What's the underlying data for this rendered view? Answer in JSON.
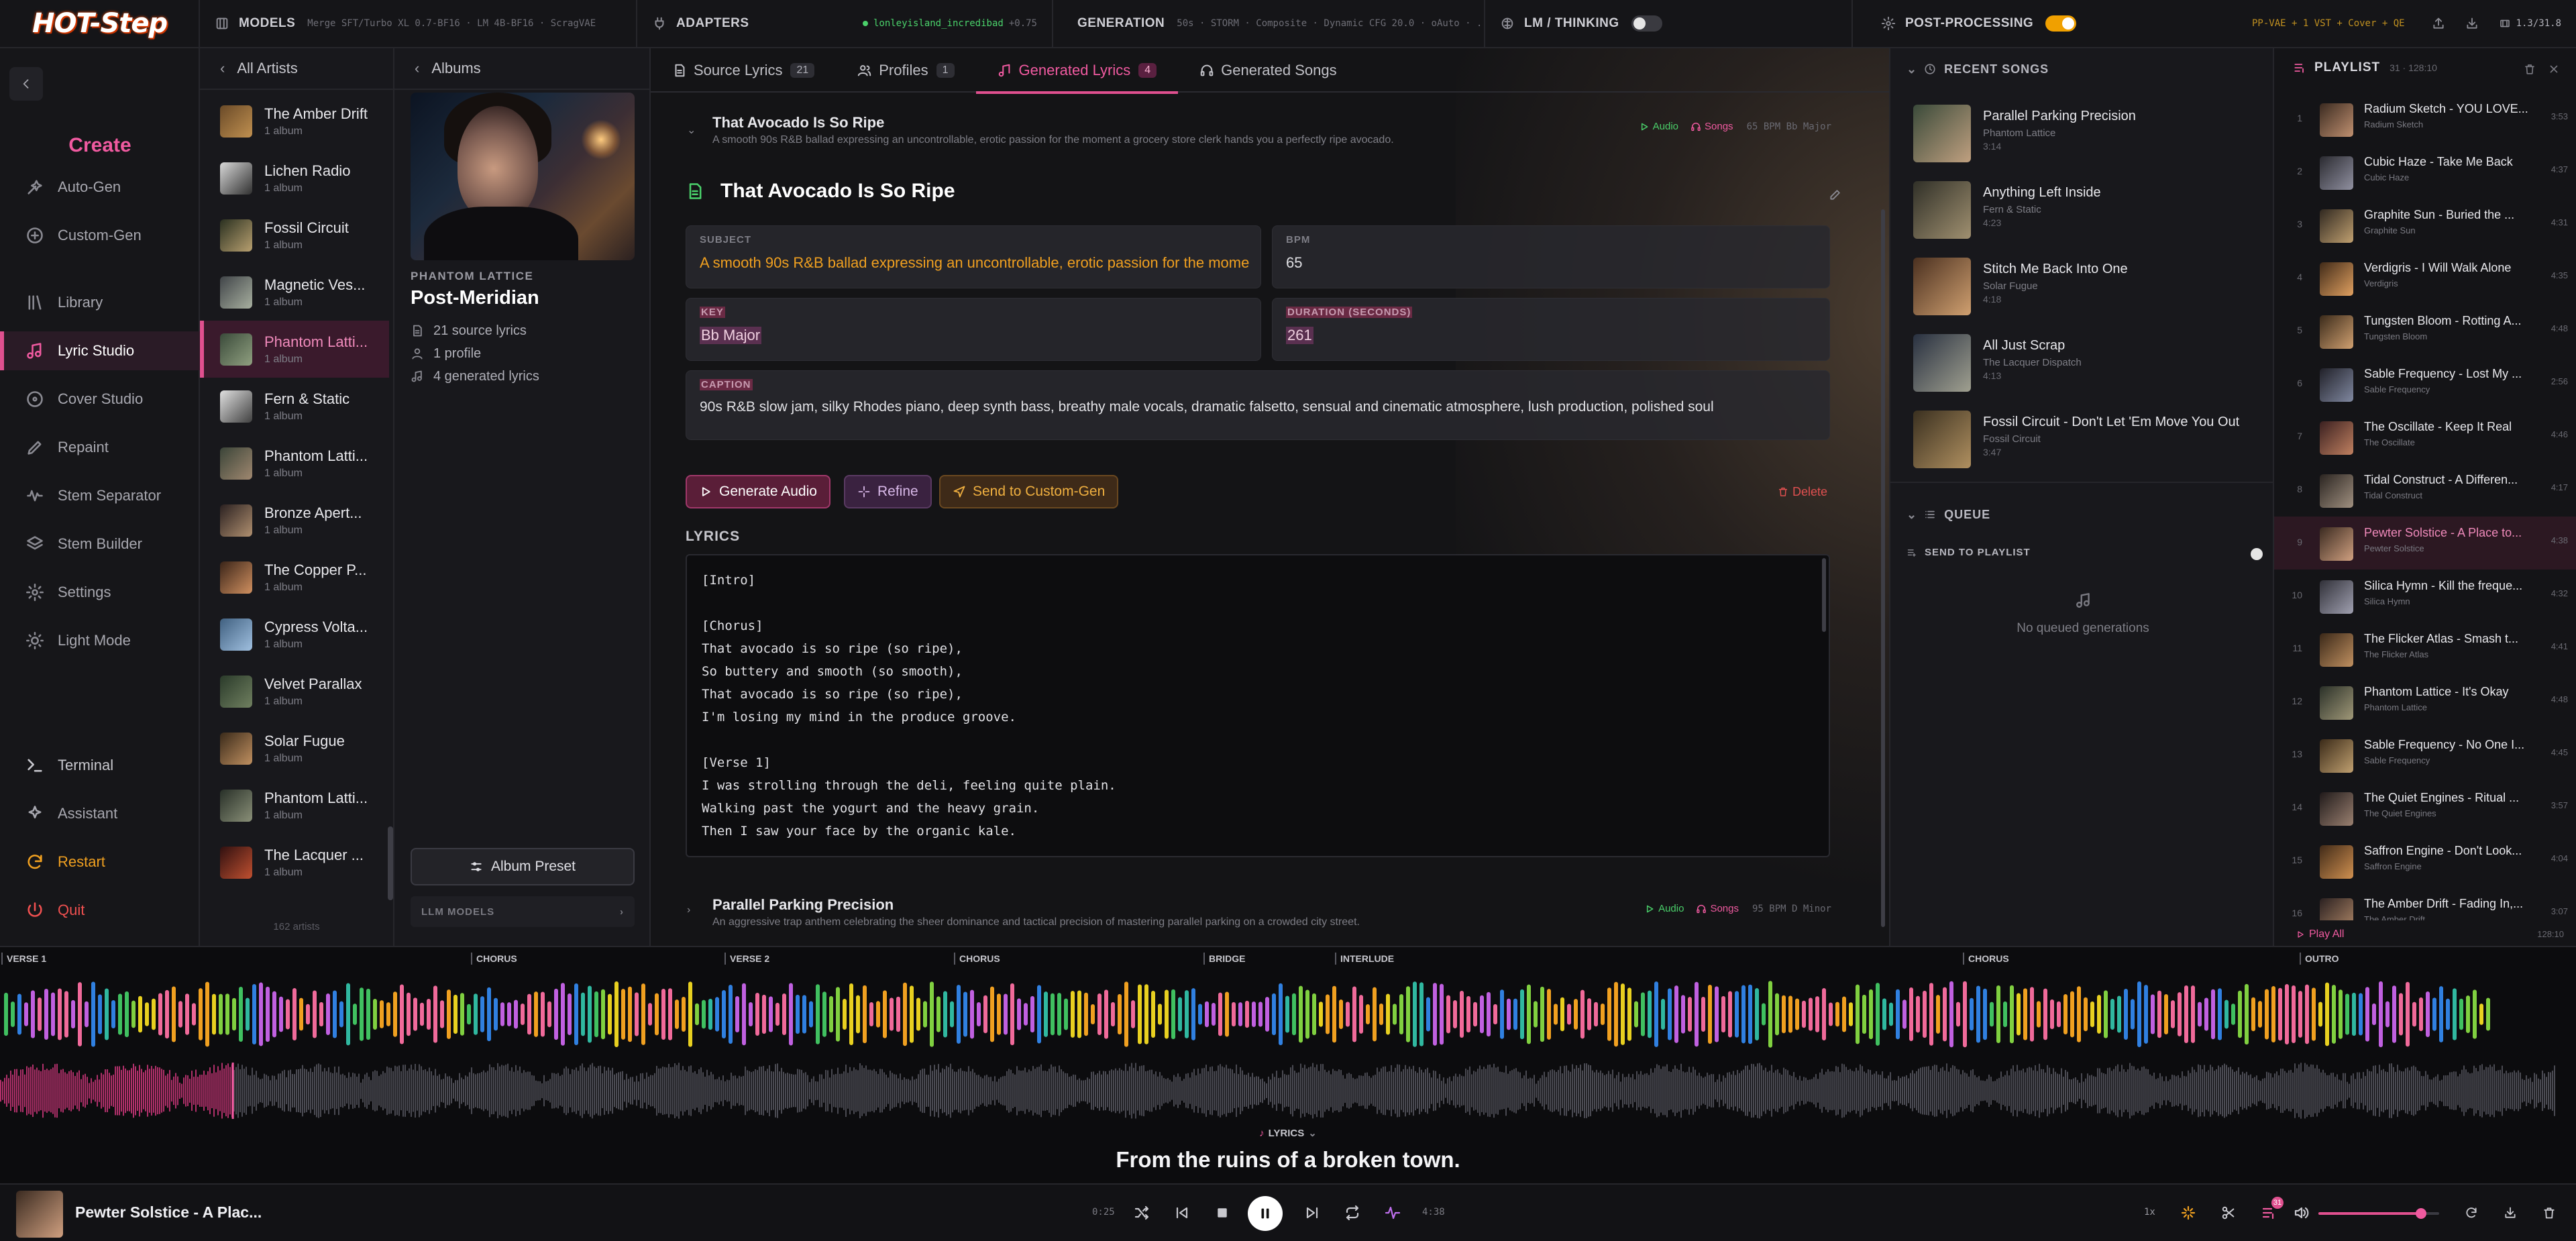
{
  "app": {
    "logo": "HOT-Step"
  },
  "topbar": {
    "models_label": "MODELS",
    "models_value": "Merge SFT/Turbo XL 0.7-BF16 · LM 4B-BF16 · ScragVAE",
    "adapters_label": "ADAPTERS",
    "adapter_value": "lonleyisland_incredibad",
    "adapter_weight": "+0.75",
    "generation_label": "GENERATION",
    "generation_value": "50s · STORM · Composite · Dynamic CFG 20.0 · oAuto · ...",
    "lm_label": "LM / THINKING",
    "post_label": "POST-PROCESSING",
    "post_value": "PP-VAE + 1 VST + Cover + QE",
    "version": "1.3/31.8"
  },
  "leftnav": {
    "create_label": "Create",
    "items": [
      {
        "label": "Auto-Gen"
      },
      {
        "label": "Custom-Gen"
      },
      {
        "label": "Library"
      },
      {
        "label": "Lyric Studio"
      },
      {
        "label": "Cover Studio"
      },
      {
        "label": "Repaint"
      },
      {
        "label": "Stem Separator"
      },
      {
        "label": "Stem Builder"
      },
      {
        "label": "Settings"
      },
      {
        "label": "Light Mode"
      }
    ],
    "bottom": [
      {
        "label": "Terminal"
      },
      {
        "label": "Assistant"
      },
      {
        "label": "Restart"
      },
      {
        "label": "Quit"
      }
    ]
  },
  "artists": {
    "header": "All Artists",
    "count": "162 artists",
    "items": [
      {
        "name": "The Amber Drift",
        "albums": "1 album",
        "c1": "#6a4a28",
        "c2": "#c09050"
      },
      {
        "name": "Lichen Radio",
        "albums": "1 album",
        "c1": "#d8d8d8",
        "c2": "#303030"
      },
      {
        "name": "Fossil Circuit",
        "albums": "1 album",
        "c1": "#2a3020",
        "c2": "#b8a070"
      },
      {
        "name": "Magnetic Ves...",
        "albums": "1 album",
        "c1": "#404448",
        "c2": "#a8b0a0"
      },
      {
        "name": "Phantom Latti...",
        "albums": "1 album",
        "c1": "#3a4a3a",
        "c2": "#90a080"
      },
      {
        "name": "Fern & Static",
        "albums": "1 album",
        "c1": "#e0e0e0",
        "c2": "#404040"
      },
      {
        "name": "Phantom Latti...",
        "albums": "1 album",
        "c1": "#3a4438",
        "c2": "#a08870"
      },
      {
        "name": "Bronze Apert...",
        "albums": "1 album",
        "c1": "#2a2020",
        "c2": "#b09070"
      },
      {
        "name": "The Copper P...",
        "albums": "1 album",
        "c1": "#3a2418",
        "c2": "#d09060"
      },
      {
        "name": "Cypress Volta...",
        "albums": "1 album",
        "c1": "#406080",
        "c2": "#a0c0e0"
      },
      {
        "name": "Velvet Parallax",
        "albums": "1 album",
        "c1": "#2a3a2a",
        "c2": "#708060"
      },
      {
        "name": "Solar Fugue",
        "albums": "1 album",
        "c1": "#3a2a1a",
        "c2": "#c09060"
      },
      {
        "name": "Phantom Latti...",
        "albums": "1 album",
        "c1": "#283028",
        "c2": "#8a9078"
      },
      {
        "name": "The Lacquer ...",
        "albums": "1 album",
        "c1": "#301010",
        "c2": "#c05030"
      }
    ]
  },
  "album": {
    "back": "Albums",
    "kicker": "PHANTOM LATTICE",
    "title": "Post-Meridian",
    "source_lyrics": "21 source lyrics",
    "profiles": "1 profile",
    "generated": "4 generated lyrics",
    "preset_btn": "Album Preset",
    "llm_label": "LLM MODELS"
  },
  "tabs": [
    {
      "label": "Source Lyrics",
      "count": "21"
    },
    {
      "label": "Profiles",
      "count": "1"
    },
    {
      "label": "Generated Lyrics",
      "count": "4"
    },
    {
      "label": "Generated Songs",
      "count": ""
    }
  ],
  "lyric_rows": [
    {
      "title": "That Avocado Is So Ripe",
      "desc": "A smooth 90s R&B ballad expressing an uncontrollable, erotic passion for the moment a grocery store clerk hands you a perfectly ripe avocado.",
      "audio": "Audio",
      "songs": "Songs",
      "tag": "65 BPM  Bb Major"
    },
    {
      "title": "Parallel Parking Precision",
      "desc": "An aggressive trap anthem celebrating the sheer dominance and tactical precision of mastering parallel parking on a crowded city street.",
      "audio": "Audio",
      "songs": "Songs",
      "tag": "95 BPM  D Minor"
    }
  ],
  "detail": {
    "title": "That Avocado Is So Ripe",
    "subject_label": "SUBJECT",
    "subject": "A smooth 90s R&B ballad expressing an uncontrollable, erotic passion for the moment a grocery store clerk hands you a perfectly ripe avocado.",
    "bpm_label": "BPM",
    "bpm": "65",
    "key_label": "KEY",
    "key": "Bb Major",
    "duration_label": "DURATION (SECONDS)",
    "duration": "261",
    "caption_label": "CAPTION",
    "caption": "90s R&B slow jam, silky Rhodes piano, deep synth bass, breathy male vocals, dramatic falsetto, sensual and cinematic atmosphere, lush production, polished soul",
    "btn_generate": "Generate Audio",
    "btn_refine": "Refine",
    "btn_send": "Send to Custom-Gen",
    "btn_delete": "Delete",
    "lyrics_label": "LYRICS",
    "lyrics": "[Intro]\n\n[Chorus]\nThat avocado is so ripe (so ripe),\nSo buttery and smooth (so smooth),\nThat avocado is so ripe (so ripe),\nI'm losing my mind in the produce groove.\n\n[Verse 1]\nI was strolling through the deli, feeling quite plain.\nWalking past the yogurt and the heavy grain.\nThen I saw your face by the organic kale."
  },
  "recent": {
    "header": "RECENT SONGS",
    "items": [
      {
        "title": "Parallel Parking Precision",
        "artist": "Phantom Lattice",
        "dur": "3:14",
        "c1": "#3a4a3a",
        "c2": "#c0a080"
      },
      {
        "title": "Anything Left Inside",
        "artist": "Fern & Static",
        "dur": "4:23",
        "c1": "#303028",
        "c2": "#a09070"
      },
      {
        "title": "Stitch Me Back Into One",
        "artist": "Solar Fugue",
        "dur": "4:18",
        "c1": "#4a3020",
        "c2": "#d0a070"
      },
      {
        "title": "All Just Scrap",
        "artist": "The Lacquer Dispatch",
        "dur": "4:13",
        "c1": "#283040",
        "c2": "#a0a090"
      },
      {
        "title": "Fossil Circuit - Don't Let 'Em Move You Out",
        "artist": "Fossil Circuit",
        "dur": "3:47",
        "c1": "#3a3020",
        "c2": "#b09060"
      }
    ],
    "queue_header": "QUEUE",
    "send_label": "SEND TO PLAYLIST",
    "empty": "No queued generations"
  },
  "playlist": {
    "header": "PLAYLIST",
    "count": "31 · 128:10",
    "play_all": "Play All",
    "total": "128:10",
    "items": [
      {
        "n": "1",
        "title": "Radium Sketch - YOU LOVE...",
        "artist": "Radium Sketch",
        "dur": "3:53",
        "c1": "#3a2a20",
        "c2": "#c09070"
      },
      {
        "n": "2",
        "title": "Cubic Haze - Take Me Back",
        "artist": "Cubic Haze",
        "dur": "4:37",
        "c1": "#2a2a30",
        "c2": "#9090a0"
      },
      {
        "n": "3",
        "title": "Graphite Sun - Buried the ...",
        "artist": "Graphite Sun",
        "dur": "4:31",
        "c1": "#302820",
        "c2": "#c0a070"
      },
      {
        "n": "4",
        "title": "Verdigris - I Will Walk Alone",
        "artist": "Verdigris",
        "dur": "4:35",
        "c1": "#402a18",
        "c2": "#e0a060"
      },
      {
        "n": "5",
        "title": "Tungsten Bloom - Rotting A...",
        "artist": "Tungsten Bloom",
        "dur": "4:48",
        "c1": "#3a2a1a",
        "c2": "#d0a070"
      },
      {
        "n": "6",
        "title": "Sable Frequency - Lost My ...",
        "artist": "Sable Frequency",
        "dur": "2:56",
        "c1": "#202028",
        "c2": "#8088a0"
      },
      {
        "n": "7",
        "title": "The Oscillate - Keep It Real",
        "artist": "The Oscillate",
        "dur": "4:46",
        "c1": "#3a2020",
        "c2": "#c08060"
      },
      {
        "n": "8",
        "title": "Tidal Construct - A Differen...",
        "artist": "Tidal Construct",
        "dur": "4:17",
        "c1": "#2a2420",
        "c2": "#a09080"
      },
      {
        "n": "9",
        "title": "Pewter Solstice - A Place to...",
        "artist": "Pewter Solstice",
        "dur": "4:38",
        "c1": "#3a2a20",
        "c2": "#d0a080"
      },
      {
        "n": "10",
        "title": "Silica Hymn - Kill the freque...",
        "artist": "Silica Hymn",
        "dur": "4:32",
        "c1": "#303038",
        "c2": "#a0a0b0"
      },
      {
        "n": "11",
        "title": "The Flicker Atlas - Smash t...",
        "artist": "The Flicker Atlas",
        "dur": "4:41",
        "c1": "#3a2818",
        "c2": "#c09060"
      },
      {
        "n": "12",
        "title": "Phantom Lattice - It's Okay",
        "artist": "Phantom Lattice",
        "dur": "4:48",
        "c1": "#2a3028",
        "c2": "#a09878"
      },
      {
        "n": "13",
        "title": "Sable Frequency - No One I...",
        "artist": "Sable Frequency",
        "dur": "4:45",
        "c1": "#3a2a18",
        "c2": "#c0a070"
      },
      {
        "n": "14",
        "title": "The Quiet Engines - Ritual ...",
        "artist": "The Quiet Engines",
        "dur": "3:57",
        "c1": "#201a1a",
        "c2": "#9a8070"
      },
      {
        "n": "15",
        "title": "Saffron Engine - Don't Look...",
        "artist": "Saffron Engine",
        "dur": "4:04",
        "c1": "#402a18",
        "c2": "#d09050"
      },
      {
        "n": "16",
        "title": "The Amber Drift - Fading In,...",
        "artist": "The Amber Drift",
        "dur": "3:07",
        "c1": "#2a2020",
        "c2": "#b08868"
      }
    ]
  },
  "sections": [
    "VERSE 1",
    "CHORUS",
    "VERSE 2",
    "CHORUS",
    "BRIDGE",
    "INTERLUDE",
    "CHORUS",
    "OUTRO"
  ],
  "lyrics_bar": {
    "toggle": "LYRICS",
    "current": "From the ruins of a broken town."
  },
  "player": {
    "title": "Pewter Solstice - A Plac...",
    "elapsed": "0:25",
    "total": "4:38",
    "speed": "1x",
    "progress": 0.09,
    "volume": 0.85,
    "queue_badge": "31"
  },
  "colors": {
    "accent": "#e0508f",
    "green": "#4ad06a",
    "amber": "#f0a020"
  }
}
